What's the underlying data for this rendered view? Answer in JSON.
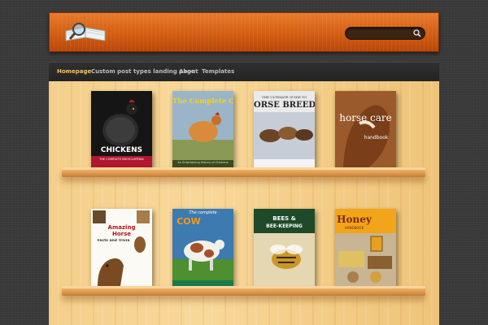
{
  "nav": {
    "items": [
      {
        "label": "Homepage"
      },
      {
        "label": "Custom post types landing page"
      },
      {
        "label": "About"
      },
      {
        "label": "Templates"
      }
    ]
  },
  "search": {
    "placeholder": ""
  },
  "books": [
    {
      "title": "CHICKENS",
      "subtitle": "THE COMPLETE ENCYCLOPEDIA"
    },
    {
      "title": "The Complete Chicken",
      "subtitle": "An Entertaining History of Chickens"
    },
    {
      "title": "THE ULTIMATE GUIDE TO",
      "subtitle": "ORSE BREED"
    },
    {
      "title": "horse care",
      "subtitle": "handbook"
    },
    {
      "title": "Amazing Horse",
      "subtitle": "Facts and Trivia"
    },
    {
      "title": "COW",
      "subtitle": "The complete"
    },
    {
      "title": "BEES &",
      "subtitle": "BEE-KEEPING"
    },
    {
      "title": "Honey",
      "subtitle": "HANDBOOK"
    }
  ],
  "colors": {
    "accent_orange": "#d35d12",
    "nav_active": "#f2c36a",
    "shelf": "#e6a45a"
  }
}
